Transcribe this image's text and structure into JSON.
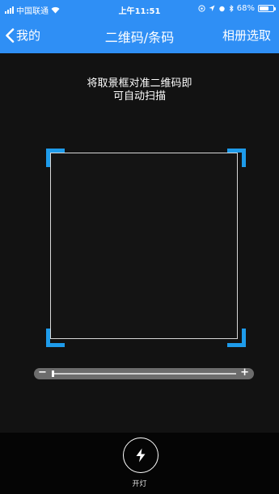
{
  "status_bar": {
    "carrier": "中国联通",
    "time": "上午11:51",
    "battery_text": "68%",
    "battery_level": 0.68
  },
  "nav": {
    "back_label": "我的",
    "title": "二维码/条码",
    "right_label": "相册选取"
  },
  "scanner": {
    "hint_line1": "将取景框对准二维码即",
    "hint_line2": "可自动扫描",
    "zoom_minus": "−",
    "zoom_plus": "+",
    "zoom_level": 0
  },
  "bottom": {
    "torch_label": "开灯"
  },
  "colors": {
    "accent": "#2f8ff5",
    "corner": "#1e9bea"
  }
}
